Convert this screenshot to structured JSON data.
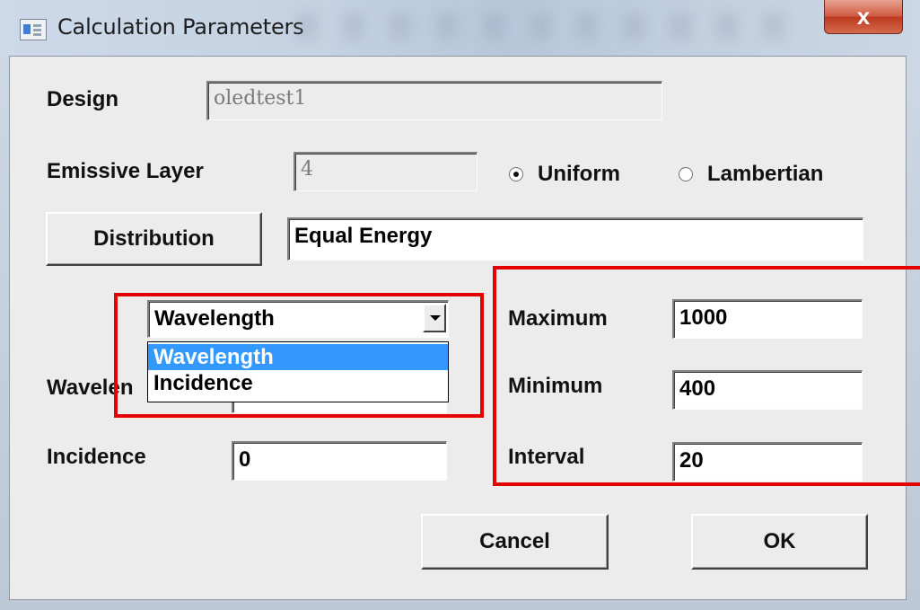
{
  "window": {
    "title": "Calculation Parameters",
    "close_glyph": "x",
    "icon": "app-window-icon"
  },
  "design": {
    "label": "Design",
    "value": "oledtest1"
  },
  "emissive_layer": {
    "label": "Emissive Layer",
    "value": "4",
    "options": [
      {
        "label": "Uniform",
        "checked": true
      },
      {
        "label": "Lambertian",
        "checked": false
      }
    ]
  },
  "distribution": {
    "button_label": "Distribution",
    "value": "Equal Energy"
  },
  "sweep": {
    "selected": "Wavelength",
    "options": [
      "Wavelength",
      "Incidence"
    ],
    "highlighted_option": "Wavelength"
  },
  "wavelength": {
    "label_visible": "Wavelen"
  },
  "incidence": {
    "label": "Incidence",
    "value": "0"
  },
  "range": {
    "maximum_label": "Maximum",
    "maximum_value": "1000",
    "minimum_label": "Minimum",
    "minimum_value": "400",
    "interval_label": "Interval",
    "interval_value": "20"
  },
  "buttons": {
    "cancel": "Cancel",
    "ok": "OK"
  },
  "colors": {
    "highlight_box": "#e40000",
    "selection": "#3399ff",
    "close_button": "#c94a30"
  }
}
